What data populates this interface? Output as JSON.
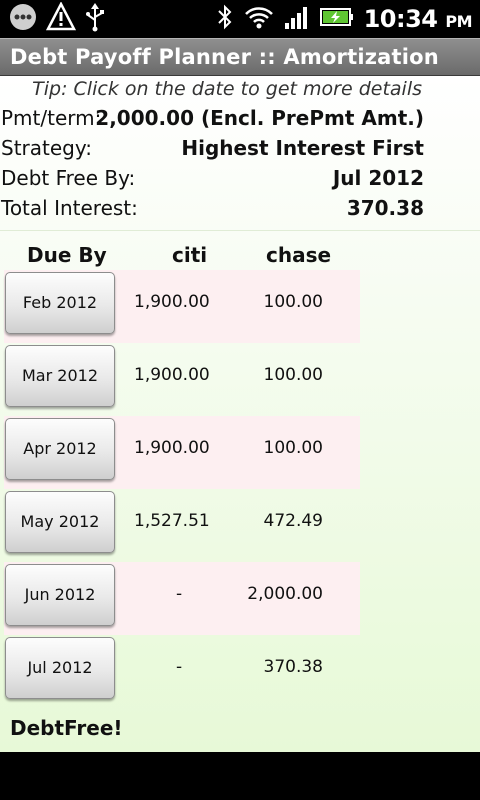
{
  "status_bar": {
    "time": "10:34",
    "ampm": "PM",
    "icons": [
      "talk-bubble-icon",
      "warning-icon",
      "usb-icon",
      "bluetooth-icon",
      "wifi-icon",
      "signal-icon",
      "battery-charging-icon"
    ]
  },
  "app": {
    "title": "Debt Payoff Planner :: Amortization"
  },
  "tip": "Tip: Click on the date to get more details",
  "summary": {
    "payment": {
      "label": "Pmt/term:",
      "value": "2,000.00 (Encl. PrePmt Amt.)"
    },
    "strategy": {
      "label": "Strategy:",
      "value": "Highest Interest First"
    },
    "debt_free_by": {
      "label": "Debt Free By:",
      "value": "Jul 2012"
    },
    "total_interest": {
      "label": "Total Interest:",
      "value": "370.38"
    }
  },
  "table": {
    "headers": [
      "Due By",
      "citi",
      "chase"
    ],
    "rows": [
      {
        "date": "Feb 2012",
        "citi": "1,900.00",
        "chase": "100.00"
      },
      {
        "date": "Mar 2012",
        "citi": "1,900.00",
        "chase": "100.00"
      },
      {
        "date": "Apr 2012",
        "citi": "1,900.00",
        "chase": "100.00"
      },
      {
        "date": "May 2012",
        "citi": "1,527.51",
        "chase": "472.49"
      },
      {
        "date": "Jun 2012",
        "citi": "-",
        "chase": "2,000.00"
      },
      {
        "date": "Jul 2012",
        "citi": "-",
        "chase": "370.38"
      }
    ]
  },
  "footer_note": "DebtFree!",
  "colors": {
    "title_bar": "#7a7a7a",
    "row_highlight": "#fdeff1",
    "content_gradient_end": "#e7f9d7"
  }
}
